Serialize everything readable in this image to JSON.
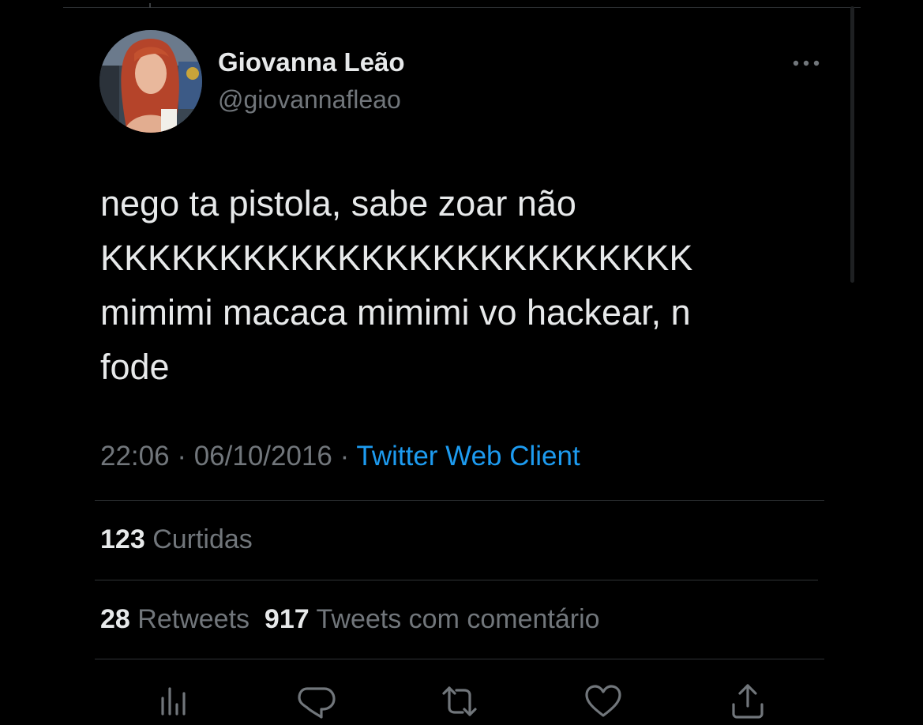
{
  "tweet": {
    "author_name": "Giovanna Leão",
    "author_handle": "@giovannafleao",
    "text": "nego ta pistola, sabe zoar não\nKKKKKKKKKKKKKKKKKKKKKKKKK\nmimimi macaca mimimi vo hackear, n\nfode",
    "time": "22:06",
    "date": "06/10/2016",
    "separator": "·",
    "source": "Twitter Web Client"
  },
  "stats": {
    "likes_count": "123",
    "likes_label": "Curtidas",
    "retweets_count": "28",
    "retweets_label": "Retweets",
    "quotes_count": "917",
    "quotes_label": "Tweets com comentário"
  },
  "icons": {
    "more": "more-horizontal-icon",
    "analytics": "analytics-icon",
    "reply": "reply-icon",
    "retweet": "retweet-icon",
    "like": "heart-icon",
    "share": "share-icon"
  },
  "colors": {
    "background": "#000000",
    "text_primary": "#e7e9ea",
    "text_secondary": "#71767b",
    "link": "#1d9bf0",
    "divider": "#2f3336"
  }
}
